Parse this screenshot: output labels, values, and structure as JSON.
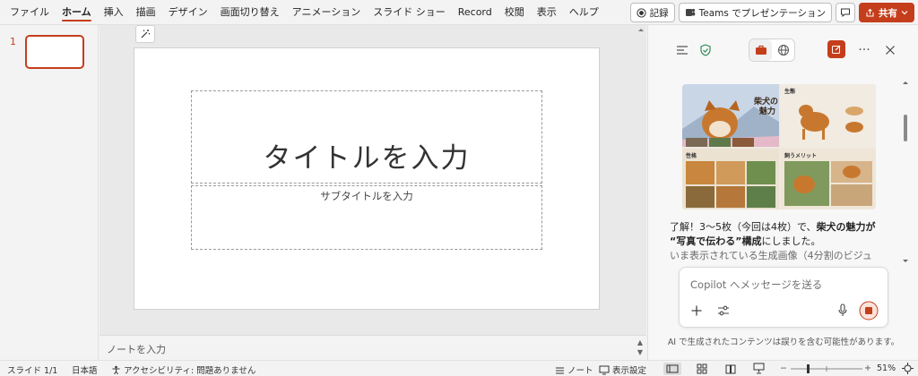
{
  "menu": {
    "tabs": [
      {
        "label": "ファイル"
      },
      {
        "label": "ホーム"
      },
      {
        "label": "挿入"
      },
      {
        "label": "描画"
      },
      {
        "label": "デザイン"
      },
      {
        "label": "画面切り替え"
      },
      {
        "label": "アニメーション"
      },
      {
        "label": "スライド ショー"
      },
      {
        "label": "Record"
      },
      {
        "label": "校閲"
      },
      {
        "label": "表示"
      },
      {
        "label": "ヘルプ"
      }
    ],
    "active_tab": "ホーム",
    "record_label": "記録",
    "teams_label": "Teams でプレゼンテーション",
    "share_label": "共有"
  },
  "thumbnails": {
    "slide_number": "1"
  },
  "slide": {
    "title_placeholder": "タイトルを入力",
    "subtitle_placeholder": "サブタイトルを入力"
  },
  "notes": {
    "placeholder": "ノートを入力"
  },
  "copilot": {
    "collage": {
      "title": "柴犬の\n魅力",
      "panel_labels": [
        "生態",
        "性格",
        "飼うメリット"
      ]
    },
    "message": {
      "line1_prefix": "了解！3〜5枚（今回は4枚）で、",
      "line1_bold": "柴犬の魅力が",
      "line2_bold": "“写真で伝わる”構成",
      "line2_suffix": "にしました。",
      "line3": "いま表示されている生成画像（4分割のビジュ"
    },
    "input_placeholder": "Copilot へメッセージを送る",
    "disclaimer": "AI で生成されたコンテンツは誤りを含む可能性があります。"
  },
  "status": {
    "slide_info": "スライド 1/1",
    "language": "日本語",
    "accessibility": "アクセシビリティ: 問題ありません",
    "notes_label": "ノート",
    "display_settings": "表示設定",
    "zoom": "51%"
  },
  "colors": {
    "accent": "#c43e1c",
    "shield_green": "#2e8b57"
  }
}
